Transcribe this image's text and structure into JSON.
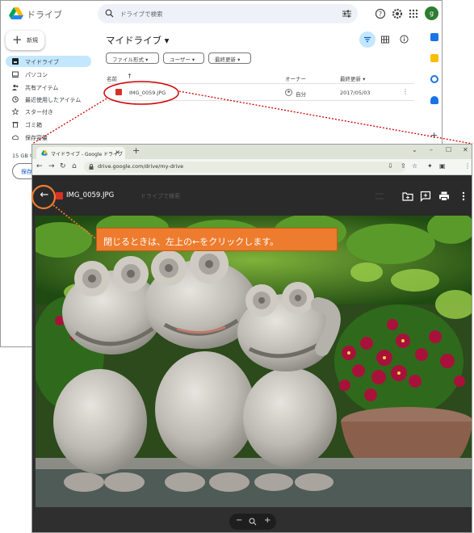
{
  "drive": {
    "app_name": "ドライブ",
    "search_placeholder": "ドライブで検索",
    "avatar_letter": "g",
    "new_button": "新規",
    "nav": [
      {
        "label": "マイドライブ"
      },
      {
        "label": "パソコン"
      },
      {
        "label": "共有アイテム"
      },
      {
        "label": "最近使用したアイテム"
      },
      {
        "label": "スター付き"
      },
      {
        "label": "ゴミ箱"
      },
      {
        "label": "保存容量"
      }
    ],
    "storage_text": "15 GB 中",
    "get_more_label": "保存",
    "page_title": "マイドライブ ▾",
    "chips": [
      "ファイル形式 ▾",
      "ユーザー ▾",
      "最終更新 ▾"
    ],
    "columns": {
      "name": "名前",
      "owner": "オーナー",
      "modified": "最終更新 ▾"
    },
    "files": [
      {
        "name": "IMG_0059.JPG",
        "owner": "自分",
        "modified": "2017/05/03"
      }
    ]
  },
  "browser": {
    "tab_title": "マイドライブ - Google ドライブ",
    "url": "drive.google.com/drive/my-drive",
    "avatar_letter": "g"
  },
  "viewer": {
    "file_name": "IMG_0059.JPG",
    "search_placeholder": "ドライブで検索"
  },
  "annotation": {
    "callout_text": "閉じるときは、左上の←をクリックします。",
    "accent_color": "#ee7c2e",
    "highlight_color": "#d00000"
  },
  "icons": [
    "drive-logo-icon",
    "search-icon",
    "tune-icon",
    "help-icon",
    "settings-icon",
    "apps-icon",
    "back-arrow-icon",
    "add-to-drive-icon",
    "comment-icon",
    "print-icon",
    "more-icon",
    "zoom-out-icon",
    "zoom-in-icon"
  ]
}
